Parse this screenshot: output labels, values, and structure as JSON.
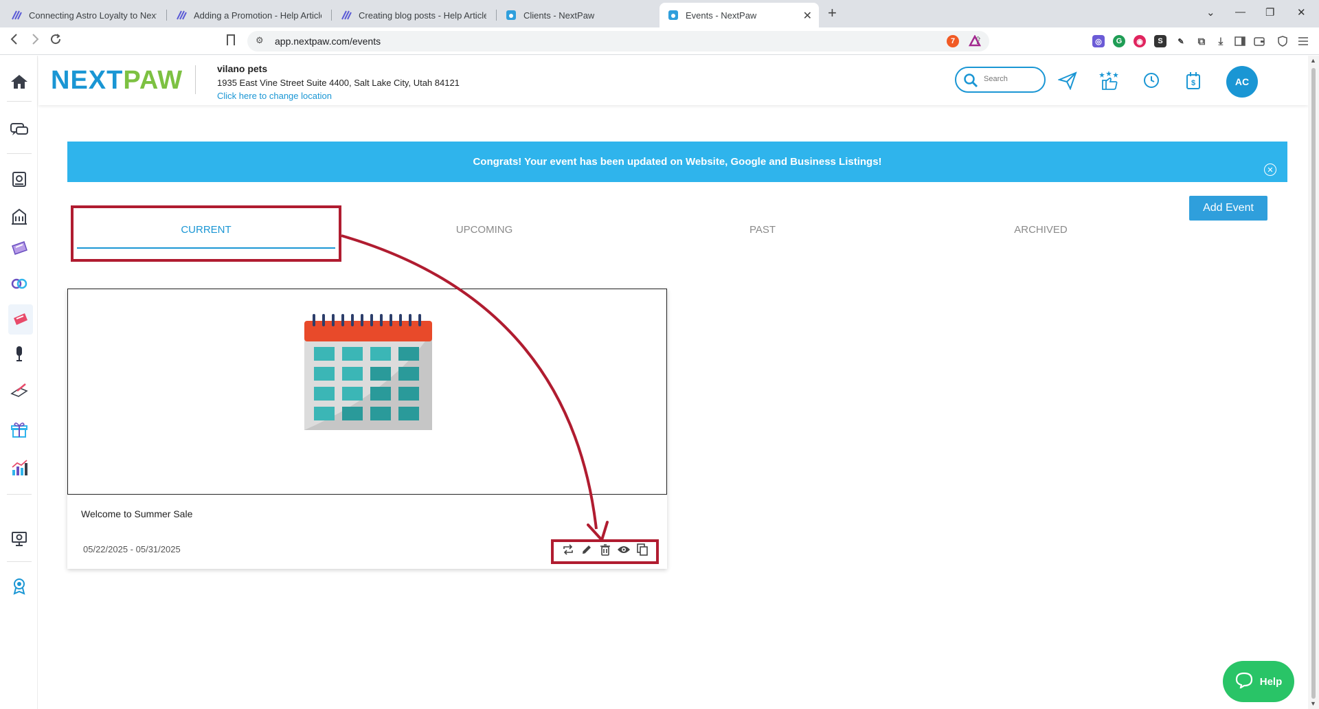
{
  "browser": {
    "tabs": [
      {
        "title": "Connecting Astro Loyalty to NextPa"
      },
      {
        "title": "Adding a Promotion - Help Articles"
      },
      {
        "title": "Creating blog posts - Help Articles"
      },
      {
        "title": "Clients - NextPaw"
      },
      {
        "title": "Events - NextPaw"
      }
    ],
    "active_tab": 4,
    "url": "app.nextpaw.com/events",
    "brave_badge": "7"
  },
  "header": {
    "logo_left": "NEXT",
    "logo_right": "PAW",
    "location_name": "vilano pets",
    "location_address": "1935 East Vine Street Suite 4400, Salt Lake City, Utah 84121",
    "change_location_link": "Click here to change location",
    "search_placeholder": "Search",
    "avatar_initials": "AC"
  },
  "banner": {
    "message": "Congrats! Your event has been updated on Website, Google and Business Listings!"
  },
  "toolbar": {
    "add_event_label": "Add Event"
  },
  "page_tabs": [
    {
      "label": "CURRENT",
      "active": true
    },
    {
      "label": "UPCOMING",
      "active": false
    },
    {
      "label": "PAST",
      "active": false
    },
    {
      "label": "ARCHIVED",
      "active": false
    }
  ],
  "events": [
    {
      "title": "Welcome to Summer Sale",
      "dates": "05/22/2025 - 05/31/2025"
    }
  ],
  "help": {
    "label": "Help"
  },
  "colors": {
    "brand_blue": "#1a96d4",
    "brand_green": "#7dc142",
    "banner": "#2fb4ec",
    "annotation": "#b01c30",
    "help": "#29c467"
  }
}
